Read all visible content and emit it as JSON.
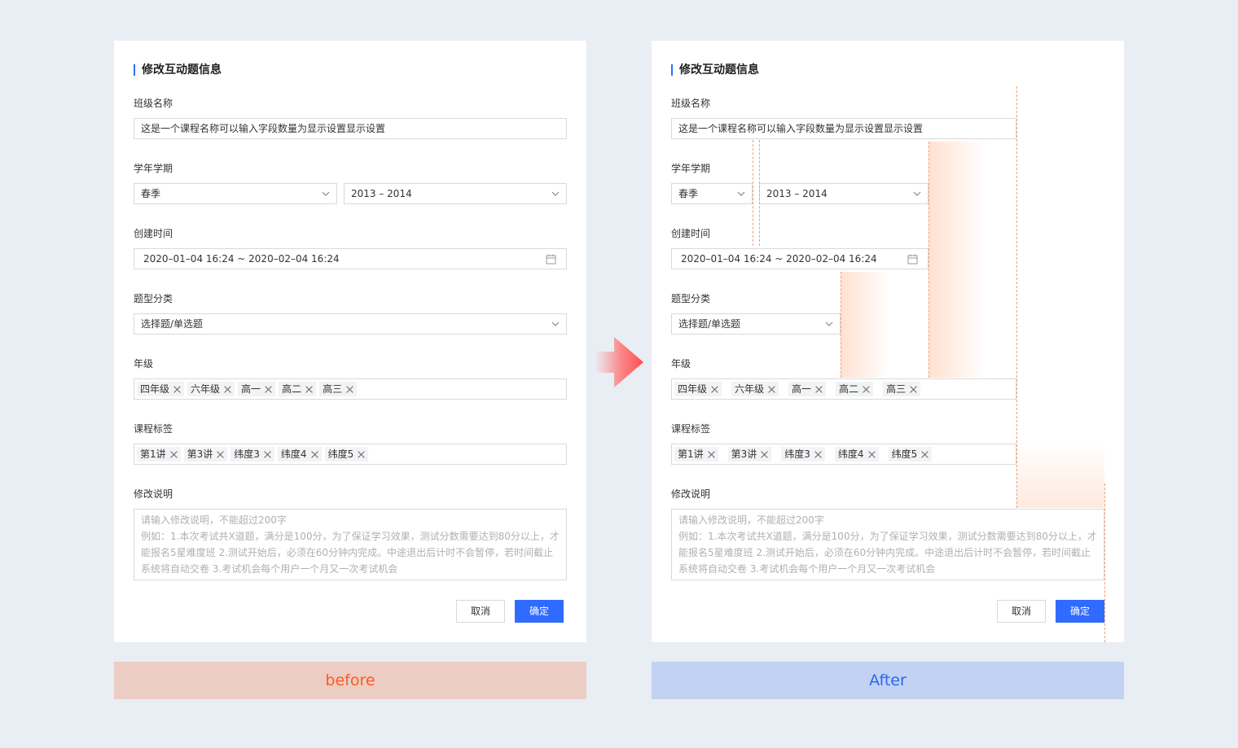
{
  "form": {
    "title": "修改互动题信息",
    "class_name_label": "班级名称",
    "class_name_value": "这是一个课程名称可以输入字段数量为显示设置显示设置",
    "term_label": "学年学期",
    "season_value": "春季",
    "year_value": "2013 – 2014",
    "created_label": "创建时间",
    "created_value": "2020–01–04 16:24 ~ 2020–02–04 16:24",
    "question_type_label": "题型分类",
    "question_type_value": "选择题/单选题",
    "grade_label": "年级",
    "grades": [
      "四年级",
      "六年级",
      "高一",
      "高二",
      "高三"
    ],
    "course_tags_label": "课程标签",
    "course_tags": [
      "第1讲",
      "第3讲",
      "纬度3",
      "纬度4",
      "纬度5"
    ],
    "note_label": "修改说明",
    "note_placeholder_lines": [
      "请输入修改说明，不能超过200字",
      "例如：1.本次考试共X道题，满分是100分，为了保证学习效果，测试分数需要达到80分以上，才",
      "能报名5星难度班   2.测试开始后，必须在60分钟内完成。中途退出后计时不会暂停，若时间截止",
      "系统将自动交卷   3.考试机会每个用户一个月又一次考试机会"
    ],
    "cancel_label": "取消",
    "confirm_label": "确定"
  },
  "captions": {
    "before": "before",
    "after": "After"
  },
  "colors": {
    "primary": "#2f6bff",
    "before_text": "#ff5a1f",
    "after_text": "#2a68ef",
    "guide": "#f0a073"
  }
}
